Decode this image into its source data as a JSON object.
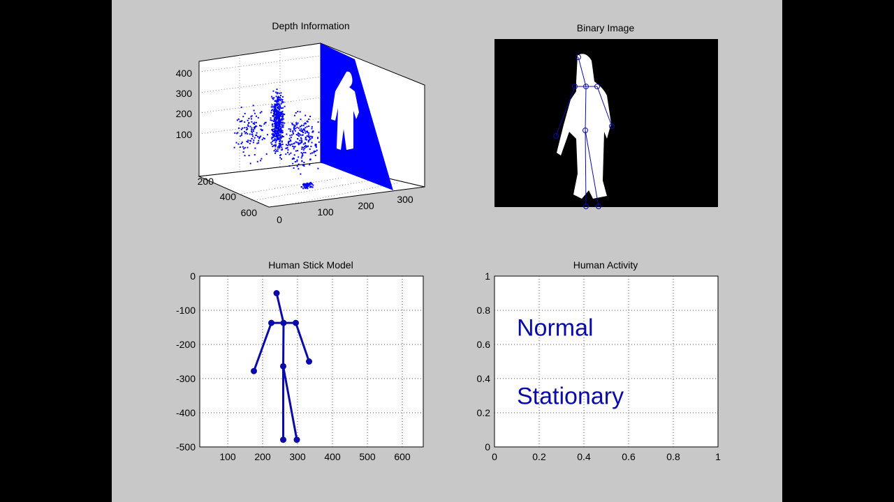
{
  "colors": {
    "figure_bg": "#c8c8c8",
    "axes_bg": "#ffffff",
    "blue": "#0000ff",
    "dark_blue": "#0a0aa8",
    "black": "#000000"
  },
  "chart_data": [
    {
      "id": "depth",
      "type": "scatter",
      "title": "Depth Information",
      "projection": "3d",
      "x_ticks": [
        "100",
        "200",
        "300"
      ],
      "y_ticks": [
        "0",
        "200",
        "400",
        "600"
      ],
      "z_ticks": [
        "100",
        "200",
        "300",
        "400"
      ],
      "series": [
        {
          "color": "#0000ff",
          "content": "depth point cloud of a standing person with binary silhouette projected on a back plane"
        }
      ]
    },
    {
      "id": "binary",
      "type": "image",
      "title": "Binary Image",
      "background": "#000000",
      "joints": [
        {
          "name": "head",
          "x": 120,
          "y": 26
        },
        {
          "name": "left_shoulder",
          "x": 115,
          "y": 68
        },
        {
          "name": "neck",
          "x": 131,
          "y": 68
        },
        {
          "name": "right_shoulder",
          "x": 147,
          "y": 68
        },
        {
          "name": "left_hand",
          "x": 88,
          "y": 139
        },
        {
          "name": "right_hand",
          "x": 168,
          "y": 125
        },
        {
          "name": "hip",
          "x": 130,
          "y": 131
        },
        {
          "name": "left_foot",
          "x": 131,
          "y": 240
        },
        {
          "name": "right_foot",
          "x": 149,
          "y": 240
        }
      ]
    },
    {
      "id": "stick",
      "type": "line",
      "title": "Human Stick Model",
      "xlim": [
        20,
        660
      ],
      "ylim": [
        -500,
        0
      ],
      "x_ticks": [
        100,
        200,
        300,
        400,
        500,
        600
      ],
      "y_ticks": [
        0,
        -100,
        -200,
        -300,
        -400,
        -500
      ],
      "grid": true,
      "joints": [
        {
          "name": "head",
          "x": 240,
          "y": -50
        },
        {
          "name": "left_shoulder",
          "x": 225,
          "y": -137
        },
        {
          "name": "neck",
          "x": 260,
          "y": -137
        },
        {
          "name": "right_shoulder",
          "x": 295,
          "y": -137
        },
        {
          "name": "left_hand",
          "x": 175,
          "y": -278
        },
        {
          "name": "right_hand",
          "x": 333,
          "y": -250
        },
        {
          "name": "hip",
          "x": 259,
          "y": -264
        },
        {
          "name": "left_foot",
          "x": 259,
          "y": -479
        },
        {
          "name": "right_foot",
          "x": 298,
          "y": -479
        }
      ],
      "bones": [
        [
          "head",
          "neck"
        ],
        [
          "left_shoulder",
          "neck"
        ],
        [
          "neck",
          "right_shoulder"
        ],
        [
          "left_shoulder",
          "left_hand"
        ],
        [
          "right_shoulder",
          "right_hand"
        ],
        [
          "neck",
          "hip"
        ],
        [
          "hip",
          "left_foot"
        ],
        [
          "hip",
          "right_foot"
        ]
      ]
    },
    {
      "id": "activity",
      "type": "table",
      "title": "Human Activity",
      "xlim": [
        0,
        1
      ],
      "ylim": [
        0,
        1
      ],
      "x_ticks": [
        "0",
        "0.2",
        "0.4",
        "0.6",
        "0.8",
        "1"
      ],
      "y_ticks": [
        "0",
        "0.2",
        "0.4",
        "0.6",
        "0.8",
        "1"
      ],
      "grid": true,
      "labels": [
        {
          "text": "Normal",
          "x": 0.1,
          "y": 0.7
        },
        {
          "text": "Stationary",
          "x": 0.1,
          "y": 0.3
        }
      ]
    }
  ]
}
